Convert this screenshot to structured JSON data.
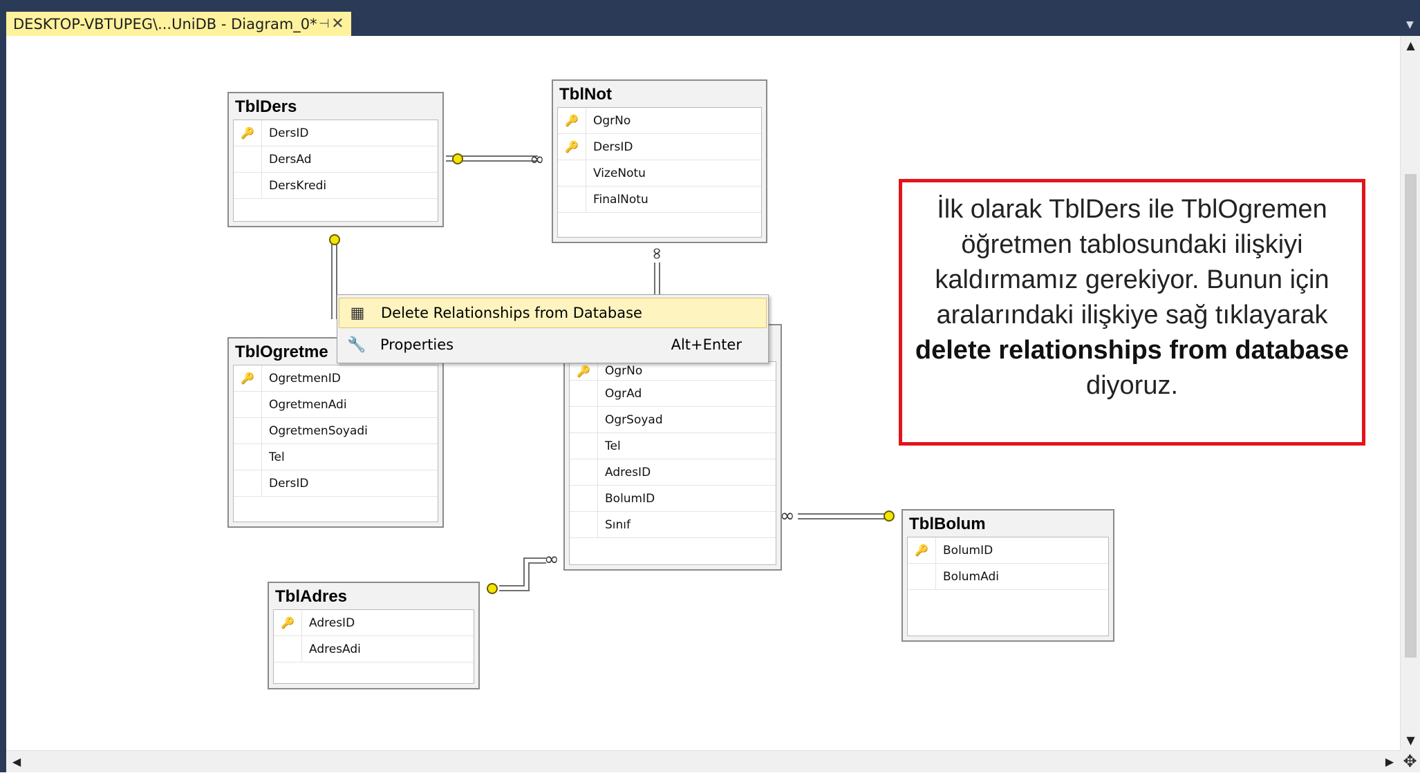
{
  "tab": {
    "title": "DESKTOP-VBTUPEG\\...UniDB - Diagram_0*",
    "pin": "⊣",
    "close": "✕"
  },
  "tables": {
    "ders": {
      "name": "TblDers",
      "cols": [
        "DersID",
        "DersAd",
        "DersKredi"
      ]
    },
    "not": {
      "name": "TblNot",
      "cols": [
        "OgrNo",
        "DersID",
        "VizeNotu",
        "FinalNotu"
      ]
    },
    "ogretmen": {
      "name": "TblOgretme",
      "cols": [
        "OgretmenID",
        "OgretmenAdi",
        "OgretmenSoyadi",
        "Tel",
        "DersID"
      ]
    },
    "ogrenci": {
      "cols": [
        "OgrNo",
        "OgrAd",
        "OgrSoyad",
        "Tel",
        "AdresID",
        "BolumID",
        "Sınıf"
      ]
    },
    "bolum": {
      "name": "TblBolum",
      "cols": [
        "BolumID",
        "BolumAdi"
      ]
    },
    "adres": {
      "name": "TblAdres",
      "cols": [
        "AdresID",
        "AdresAdi"
      ]
    }
  },
  "context_menu": {
    "items": [
      {
        "label": "Delete Relationships from Database",
        "icon": "delete-table-icon",
        "shortcut": ""
      },
      {
        "label": "Properties",
        "icon": "wrench-icon",
        "shortcut": "Alt+Enter"
      }
    ]
  },
  "callout": {
    "text1": "İlk olarak TblDers ile TblOgremen öğretmen tablosundaki ilişkiyi kaldırmamız gerekiyor. Bunun için aralarındaki ilişkiye sağ tıklayarak ",
    "bold": "delete relationships from database",
    "text2": " diyoruz."
  },
  "colors": {
    "frame": "#2b3b57",
    "tab": "#fff29d",
    "callout_border": "#e3141b",
    "key": "#c99a00"
  }
}
